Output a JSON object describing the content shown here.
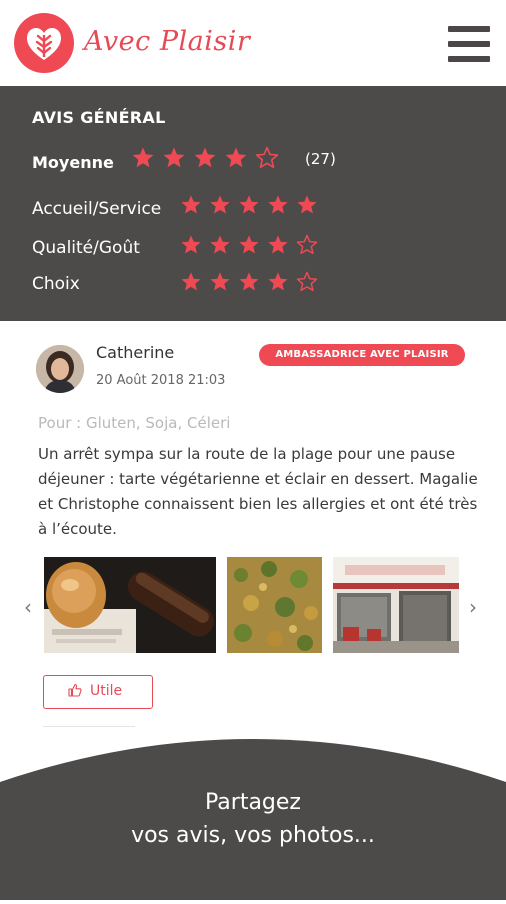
{
  "header": {
    "brand": "Avec Plaisir",
    "logo_icon": "wheat-heart-icon",
    "menu_icon": "hamburger-menu-icon",
    "accent_color": "#ef4a54"
  },
  "summary": {
    "title": "AVIS GÉNÉRAL",
    "average": {
      "label": "Moyenne",
      "rating": 4,
      "max": 5,
      "count": "(27)"
    },
    "criteria": [
      {
        "label": "Accueil/Service",
        "rating": 5,
        "max": 5
      },
      {
        "label": "Qualité/Goût",
        "rating": 4,
        "max": 5
      },
      {
        "label": "Choix",
        "rating": 4,
        "max": 5
      }
    ],
    "background_color": "#4d4a4a"
  },
  "review": {
    "author": "Catherine",
    "date": "20 Août 2018 21:03",
    "badge": "AMBASSADRICE AVEC PLAISIR",
    "for_line": "Pour : Gluten, Soja, Céleri",
    "text": "Un arrêt sympa sur la route de la plage pour une pause déjeuner : tarte végétarienne et éclair en dessert. Magalie et Christophe connaissent bien les allergies et ont été très à l’écoute.",
    "photos": [
      "photo-pastries",
      "photo-vegetable-tart",
      "photo-restaurant-front"
    ],
    "prev_icon": "chevron-left-icon",
    "next_icon": "chevron-right-icon",
    "useful_label": "Utile",
    "useful_icon": "thumbs-up-icon"
  },
  "footer": {
    "line1": "Partagez",
    "line2": "vos avis, vos photos..."
  }
}
